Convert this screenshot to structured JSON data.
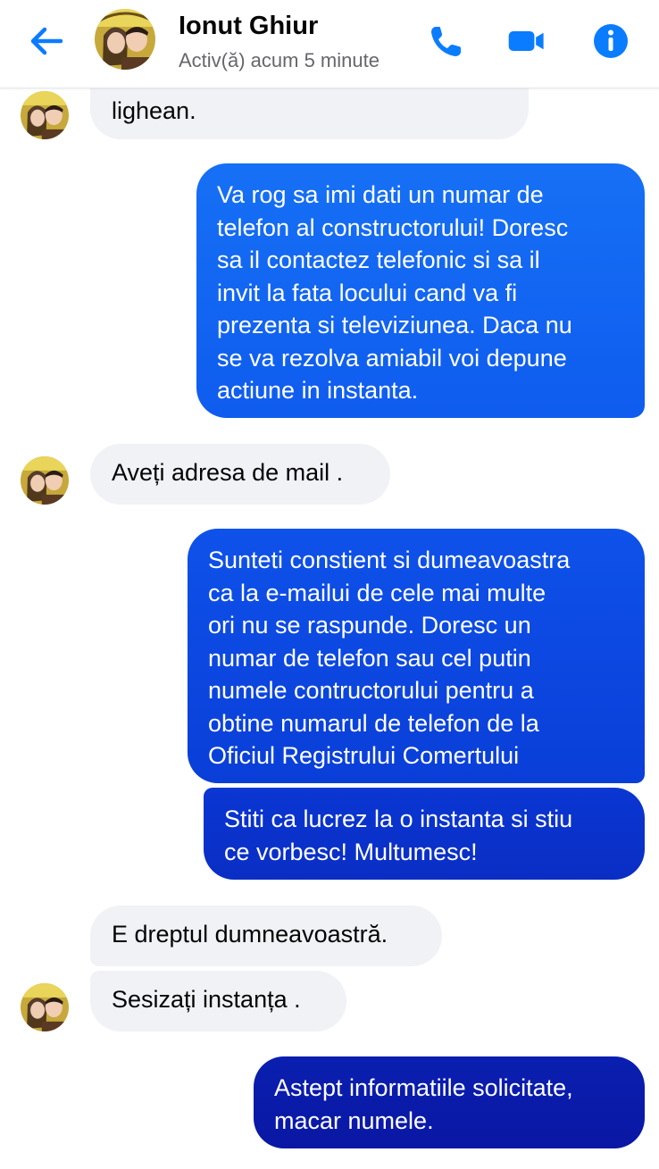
{
  "header": {
    "contact_name": "Ionut Ghiur",
    "status": "Activ(ă) acum 5 minute",
    "back_icon": "arrow-left-icon",
    "call_icon": "phone-icon",
    "video_icon": "video-camera-icon",
    "info_icon": "info-icon",
    "accent_color": "#0a7cff"
  },
  "messages": [
    {
      "direction": "incoming",
      "lines": [
        "lighean."
      ]
    },
    {
      "direction": "outgoing",
      "lines": [
        "Va rog sa imi dati un numar de",
        "telefon al constructorului! Doresc",
        "sa il contactez telefonic si sa il",
        "invit la fata locului cand va fi",
        "prezenta si televiziunea. Daca nu",
        "se va rezolva amiabil voi depune",
        "actiune in instanta."
      ]
    },
    {
      "direction": "incoming",
      "lines": [
        "Aveți adresa de mail ."
      ]
    },
    {
      "direction": "outgoing",
      "lines": [
        "Sunteti constient si dumeavoastra",
        "ca la e-mailui de cele mai multe",
        "ori nu se raspunde. Doresc un",
        "numar de telefon sau cel putin",
        "numele contructorului pentru a",
        "obtine numarul de telefon de la",
        "Oficiul Registrului Comertului"
      ]
    },
    {
      "direction": "outgoing",
      "lines": [
        "Stiti ca lucrez la o instanta si stiu",
        "ce vorbesc! Multumesc!"
      ]
    },
    {
      "direction": "incoming",
      "lines": [
        "E dreptul dumneavoastră."
      ]
    },
    {
      "direction": "incoming",
      "lines": [
        "Sesizați instanța ."
      ]
    },
    {
      "direction": "outgoing",
      "lines": [
        "Astept informatiile solicitate,",
        "macar numele."
      ]
    }
  ],
  "colors": {
    "outgoing_top": "#1670f5",
    "outgoing_mid": "#0b3fe0",
    "outgoing_bottom": "#0a1ba8",
    "incoming_bg": "#f0f2f5"
  }
}
